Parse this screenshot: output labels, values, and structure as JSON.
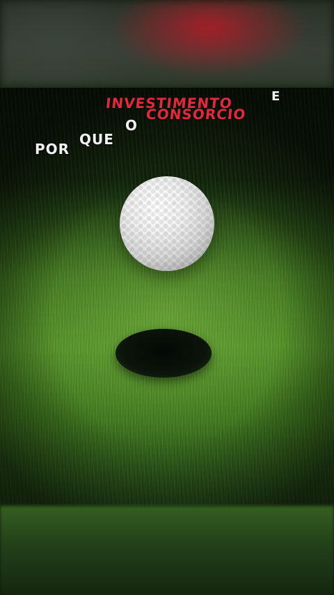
{
  "headline": {
    "word_1": "POR",
    "word_2": "QUE",
    "word_3": "O",
    "word_4": "INVESTIMENTO",
    "word_5": "CONSÓRCIO",
    "word_6": "E"
  },
  "colors": {
    "accent_red": "#e2283b",
    "text_white": "#f2f2f2",
    "grass_green": "#4f8c28"
  }
}
